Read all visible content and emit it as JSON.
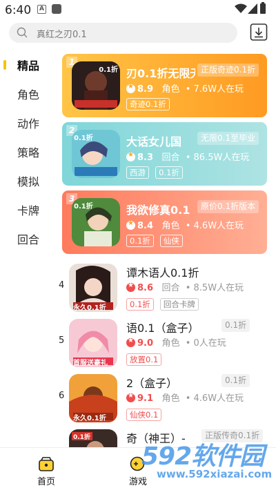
{
  "status_bar": {
    "time": "6:40"
  },
  "search": {
    "placeholder": "真红之刃0.1"
  },
  "sidebar": {
    "items": [
      {
        "label": "精品",
        "active": true
      },
      {
        "label": "角色"
      },
      {
        "label": "动作"
      },
      {
        "label": "策略"
      },
      {
        "label": "模拟"
      },
      {
        "label": "卡牌"
      },
      {
        "label": "回合"
      }
    ]
  },
  "top_cards": [
    {
      "rank": "1",
      "name": "刃0.1折无限无",
      "tag": "正版奇迹0.1折",
      "score": "8.9",
      "category": "角色",
      "players": "7.6W人在玩",
      "chips": [
        "奇迹0.1折"
      ],
      "icon_text": "0.1折"
    },
    {
      "rank": "2",
      "name": "大话女儿国",
      "tag": "无限0.1至毕业",
      "score": "8.3",
      "category": "回合",
      "players": "86.5W人在玩",
      "chips": [
        "西游",
        "0.1折"
      ],
      "icon_text": "0.1折"
    },
    {
      "rank": "3",
      "name": "我欲修真0.1",
      "tag": "原价0.1折版本",
      "score": "8.4",
      "category": "角色",
      "players": "4.6W人在玩",
      "chips": [
        "0.1折",
        "仙侠"
      ],
      "icon_text": "0.1折"
    }
  ],
  "list_items": [
    {
      "rank": "4",
      "name": "谭木语人0.1折",
      "tag": "",
      "score": "8.6",
      "category": "回合",
      "players": "8.5W人在玩",
      "chips": [
        "0.1折",
        "回合卡牌"
      ],
      "icon_text": "永久0.1折"
    },
    {
      "rank": "5",
      "name": "语0.1（盒子）",
      "tag": "0.1折",
      "score": "9.0",
      "category": "角色",
      "players": "0人在玩",
      "chips": [
        "放置0.1"
      ],
      "icon_text": "首服送豪礼"
    },
    {
      "rank": "6",
      "name": "2（盒子）",
      "tag": "0.1折",
      "score": "9.1",
      "category": "角色",
      "players": "4.6W人在玩",
      "chips": [
        "仙侠0.1"
      ],
      "icon_text": "永久0.1折"
    },
    {
      "rank": "",
      "name": "奇（神王）-",
      "tag": "正版传奇0.1折",
      "score": "",
      "category": "",
      "players": "",
      "chips": [],
      "icon_text": "0.1折"
    }
  ],
  "bottom_nav": [
    {
      "label": "首页"
    },
    {
      "label": "游戏"
    }
  ],
  "watermark": {
    "big": "592软件园",
    "url": "www.592xiazai.com"
  }
}
